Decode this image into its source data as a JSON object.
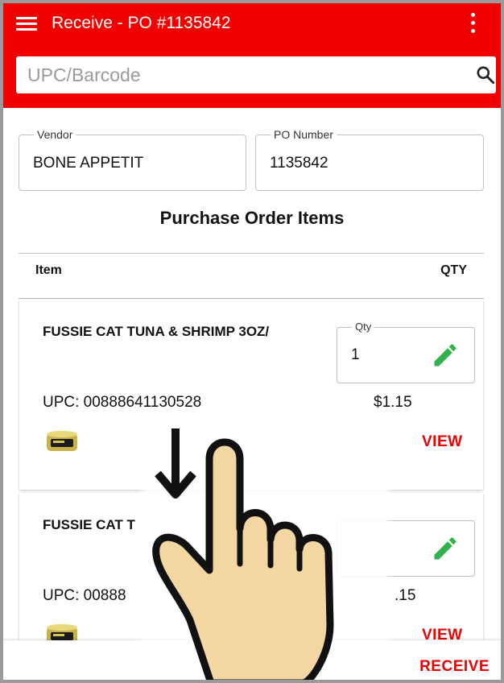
{
  "appbar": {
    "title": "Receive - PO #1135842",
    "menu_icon": "menu-icon",
    "more_icon": "more-vert-icon",
    "color": "#f20000"
  },
  "search": {
    "placeholder": "UPC/Barcode",
    "value": "",
    "icon": "search-icon"
  },
  "vendor": {
    "label": "Vendor",
    "value": "BONE APPETIT"
  },
  "po_number": {
    "label": "PO Number",
    "value": "1135842"
  },
  "section_title": "Purchase Order Items",
  "columns": {
    "item": "Item",
    "qty": "QTY"
  },
  "items": [
    {
      "name": "FUSSIE CAT TUNA & SHRIMP 3OZ/",
      "qty_label": "Qty",
      "qty_value": "1",
      "upc": "UPC: 00888641130528",
      "price": "$1.15",
      "view_label": "VIEW",
      "edit_icon": "pencil-icon"
    },
    {
      "name": "FUSSIE CAT T",
      "qty_label": "",
      "qty_value": "",
      "upc": "UPC: 00888",
      "price": ".15",
      "view_label": "VIEW",
      "edit_icon": "pencil-icon"
    }
  ],
  "bottom_bar": {
    "receive_label": "RECEIVE"
  },
  "overlay": {
    "gesture": "swipe-down",
    "icons": [
      "hand-pointer-icon",
      "arrow-down-icon"
    ]
  },
  "colors": {
    "accent": "#ee0000",
    "edit_green": "#2fb24c"
  }
}
